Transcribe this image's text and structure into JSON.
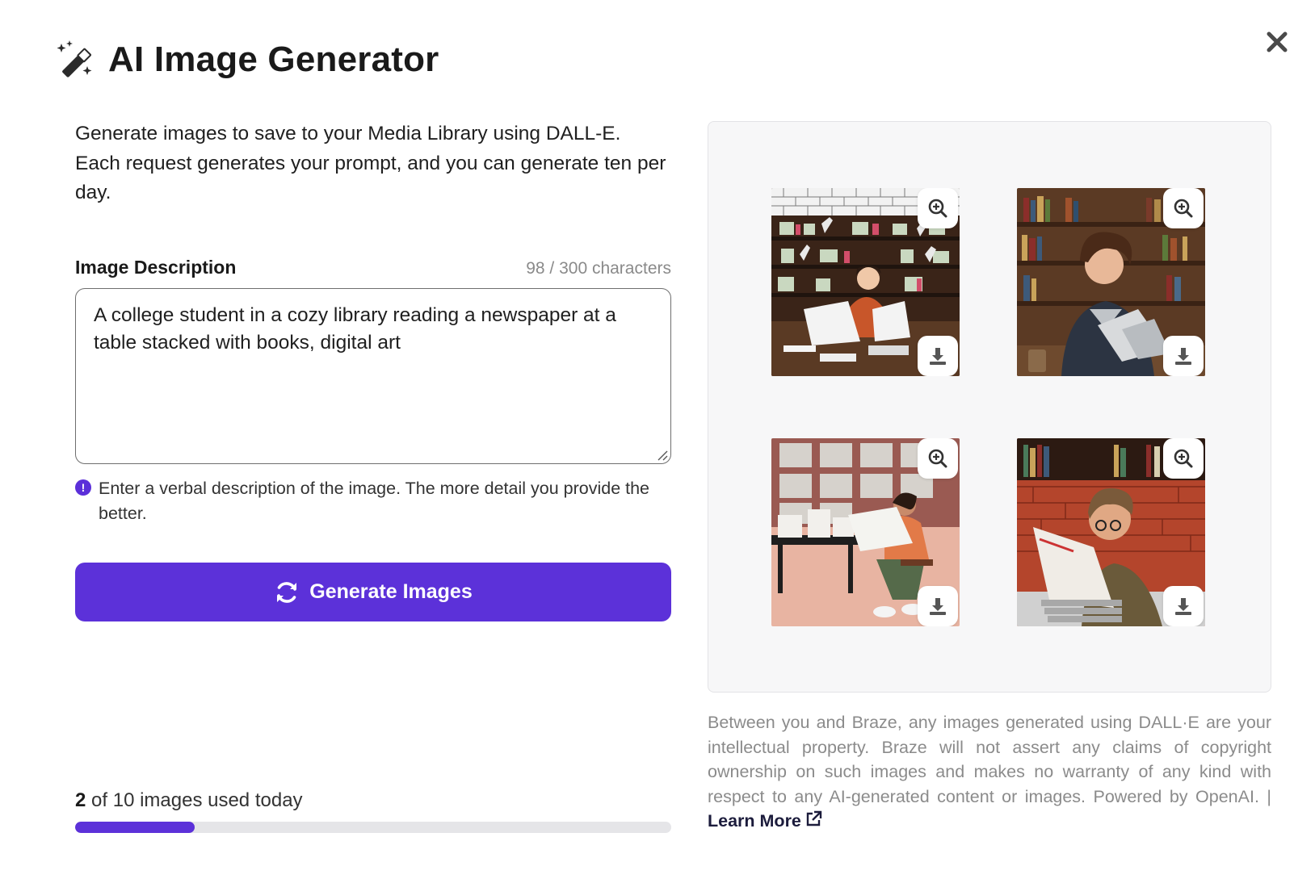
{
  "dialog": {
    "title": "AI Image Generator",
    "close_label": "×"
  },
  "intro": "Generate images to save to your Media Library using DALL-E. Each request generates your prompt, and you can generate ten per day.",
  "field": {
    "label": "Image Description",
    "char_count": "98 / 300 characters",
    "value": "A college student in a cozy library reading a newspaper at a table stacked with books, digital art",
    "hint_icon": "!",
    "hint": "Enter a verbal description of the image. The more detail you provide the better."
  },
  "generate_button": {
    "label": "Generate Images",
    "icon": "refresh-icon"
  },
  "usage": {
    "used": "2",
    "text": "of 10 images used today",
    "fraction": 0.2
  },
  "gallery": {
    "images": [
      {
        "id": 1,
        "zoom_icon": "zoom-in-icon",
        "download_icon": "download-icon"
      },
      {
        "id": 2,
        "zoom_icon": "zoom-in-icon",
        "download_icon": "download-icon"
      },
      {
        "id": 3,
        "zoom_icon": "zoom-in-icon",
        "download_icon": "download-icon"
      },
      {
        "id": 4,
        "zoom_icon": "zoom-in-icon",
        "download_icon": "download-icon"
      }
    ]
  },
  "disclaimer": {
    "text": "Between you and Braze, any images generated using DALL·E are your intellectual property. Braze will not assert any claims of copyright ownership on such images and makes no warranty of any kind with respect to any AI-generated content or images. Powered by OpenAI. | ",
    "link_label": "Learn More"
  },
  "colors": {
    "accent": "#5c31d9",
    "muted_text": "#8b8b8b",
    "gallery_bg": "#f7f7f8"
  }
}
